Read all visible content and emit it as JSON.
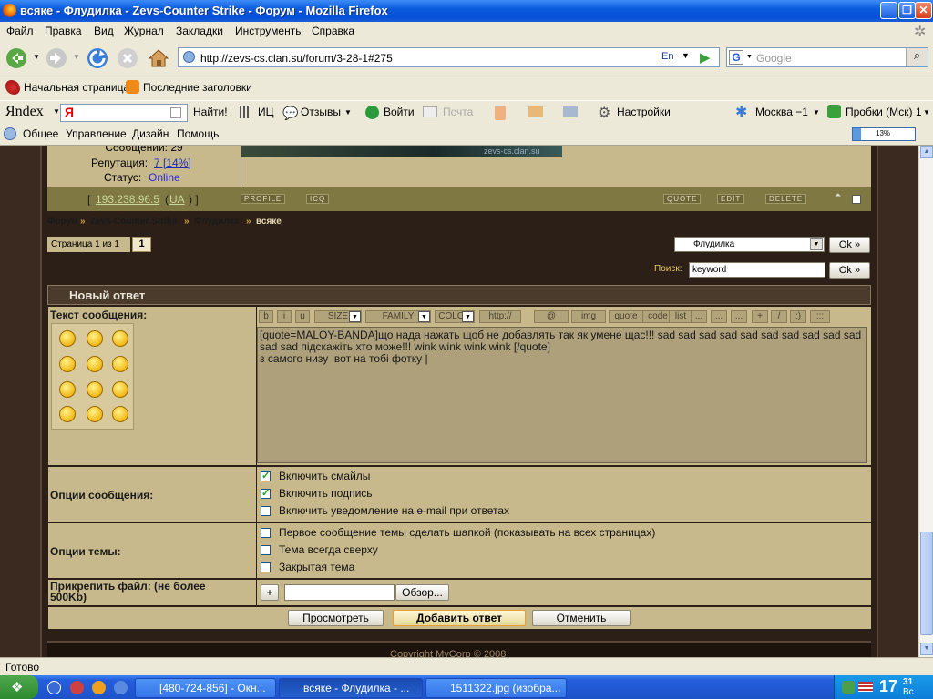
{
  "window": {
    "title": "всяке - Флудилка - Zevs-Counter Strike - Форум - Mozilla Firefox"
  },
  "menu": [
    "Файл",
    "Правка",
    "Вид",
    "Журнал",
    "Закладки",
    "Инструменты",
    "Справка"
  ],
  "nav": {
    "url": "http://zevs-cs.clan.su/forum/3-28-1#275",
    "lang": "En",
    "search_placeholder": "Google"
  },
  "bookmarks": {
    "home": "Начальная страница",
    "headlines": "Последние заголовки"
  },
  "yandex": {
    "logo": "Яndex",
    "find": "Найти!",
    "ic": "ИЦ",
    "reviews": "Отзывы",
    "login": "Войти",
    "mail": "Почта",
    "settings": "Настройки",
    "weather": "Москва −1",
    "traffic": "Пробки (Мск)  1"
  },
  "tabs2": {
    "general": "Общее",
    "manage": "Управление",
    "design": "Дизайн",
    "help": "Помощь",
    "progress": "13%"
  },
  "profile": {
    "messages": "Сообщений: 29",
    "rep_label": "Репутация:",
    "rep_value": "7 [14%]",
    "status_label": "Статус:",
    "status_value": "Online",
    "ip": "193.238.96.5",
    "country": "UA",
    "sig": "zevs-cs.clan.su"
  },
  "post_buttons": {
    "profile": "PROFILE",
    "icq": "ICQ",
    "quote": "QUOTE",
    "edit": "EDIT",
    "delete": "DELETE"
  },
  "breadcrumb": {
    "forum": "Форум",
    "section": "Zevs-Counter Strike",
    "sub": "Флудилка",
    "current": "всяке",
    "sep": "»"
  },
  "paging": {
    "label": "Страница 1 из 1",
    "current": "1"
  },
  "jump": {
    "selected": "Флудилка",
    "ok": "Ok »",
    "search_label": "Поиск:",
    "search_value": "keyword"
  },
  "form": {
    "header": "Новый ответ",
    "text_label": "Текст сообщения:",
    "editor_buttons": [
      "b",
      "i",
      "u",
      "SIZE",
      "FAMILY",
      "COLOR",
      "http://",
      "@",
      "img",
      "quote",
      "code",
      "list",
      "...",
      "...",
      "...",
      "+",
      "/",
      ":)",
      ":::"
    ],
    "message": "[quote=MALOY-BANDA]що нада нажать щоб не добавлять так як умене щас!!! sad sad sad sad sad sad sad sad sad sad sad sad підскажіть хто може!!! wink wink wink wink [/quote]\nз самого низу  вот на тобі фотку |",
    "msg_options_label": "Опции сообщения:",
    "msg_options": [
      {
        "label": "Включить смайлы",
        "checked": true
      },
      {
        "label": "Включить подпись",
        "checked": true
      },
      {
        "label": "Включить уведомление на e-mail при ответах",
        "checked": false
      }
    ],
    "topic_options_label": "Опции темы:",
    "topic_options": [
      {
        "label": "Первое сообщение темы сделать шапкой (показывать на всех страницах)",
        "checked": false
      },
      {
        "label": "Тема всегда сверху",
        "checked": false
      },
      {
        "label": "Закрытая тема",
        "checked": false
      }
    ],
    "attach_label": "Прикрепить файл: (не более 500Kb)",
    "plus": "+",
    "browse": "Обзор...",
    "preview": "Просмотреть",
    "submit": "Добавить ответ",
    "cancel": "Отменить",
    "copyright": "Copyright MyCorp © 2008"
  },
  "status": "Готово",
  "taskbar": {
    "items": [
      "[480-724-856] - Окн...",
      "всяке - Флудилка - ...",
      "1511322.jpg (изобра..."
    ],
    "time": "17",
    "time_min": "31",
    "day": "Вс"
  }
}
